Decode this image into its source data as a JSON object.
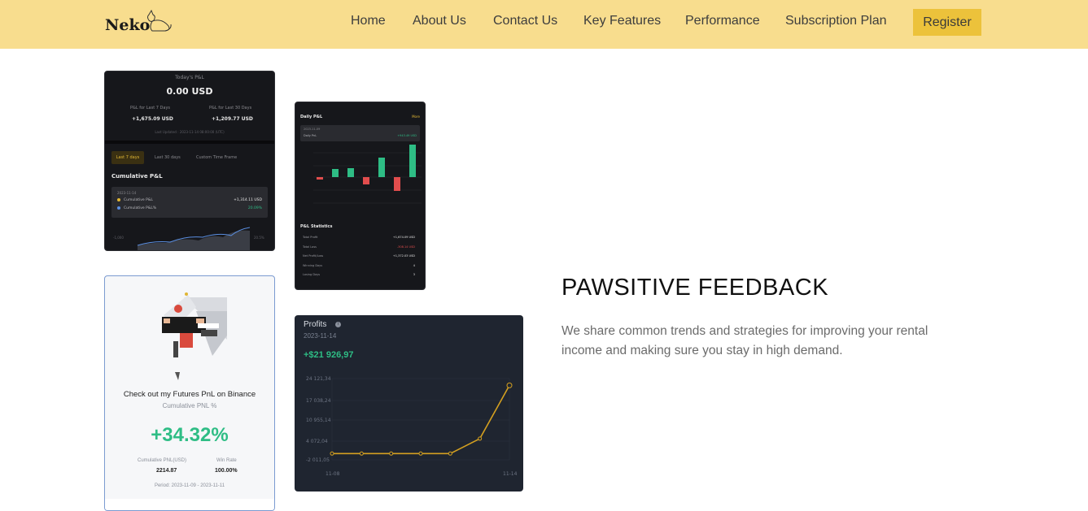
{
  "nav": {
    "logo": "Neko",
    "links": [
      "Home",
      "About Us",
      "Contact Us",
      "Key Features",
      "Performance",
      "Subscription Plan"
    ],
    "register": "Register",
    "bg_color": "#f8dd8e",
    "register_color": "#ecc23b"
  },
  "section": {
    "heading": "PAWSITIVE FEEDBACK",
    "description": "We share common trends and strategies for improving your rental income and making sure you stay in high demand."
  },
  "card_pnl": {
    "title": "Today's P&L",
    "value": "0.00 USD",
    "left_label": "P&L for Last 7 Days",
    "left_value": "+1,675.09 USD",
    "right_label": "P&L for Last 30 Days",
    "right_value": "+1,209.77 USD",
    "updated": "Last Updated : 2023-11-14 08:00:00 (UTC)",
    "tabs": [
      "Last 7 days",
      "Last 30 days",
      "Custom Time Frame"
    ],
    "section_title": "Cumulative P&L",
    "date": "2023-11-14",
    "rows": [
      {
        "label": "Cumulative P&L",
        "value": "+1,314.11 USD"
      },
      {
        "label": "Cumulative P&L%",
        "value": "20.09%"
      }
    ],
    "axis_left": "-1,000",
    "axis_right": "20.5%"
  },
  "card_daily": {
    "title": "Daily P&L",
    "more": "More",
    "tooltip_date": "2023-11-09",
    "tooltip_label": "Daily PnL",
    "tooltip_value": "+943.49 USD",
    "stats_title": "P&L Statistics",
    "stats": [
      {
        "label": "Total Profit",
        "value": "+1,674.09 USD",
        "color": "#e6e6e6"
      },
      {
        "label": "Total Loss",
        "value": "-308.14 USD",
        "color": "#e24d4d"
      },
      {
        "label": "Net Profit/Loss",
        "value": "+1,372.03 USD",
        "color": "#e6e6e6"
      },
      {
        "label": "Winning Days",
        "value": "4",
        "color": "#e6e6e6"
      },
      {
        "label": "Losing Days",
        "value": "3",
        "color": "#e6e6e6"
      }
    ],
    "bars": [
      -0.15,
      0.5,
      0.55,
      -0.45,
      1.2,
      -0.85,
      2.0
    ]
  },
  "card_binance": {
    "headline": "Check out my Futures PnL on Binance",
    "sub": "Cumulative PNL %",
    "pnl": "+34.32%",
    "stat1_label": "Cumulative PNL(USD)",
    "stat1_value": "2214.87",
    "stat2_label": "Win Rate",
    "stat2_value": "100.00%",
    "period": "Period: 2023-11-09 - 2023-11-11",
    "pnl_color": "#2ebd85"
  },
  "chart_data": {
    "type": "line",
    "title": "Profits",
    "date": "2023-11-14",
    "total": "+$21 926,97",
    "y_ticks": [
      "24 121,34",
      "17 038,24",
      "10 955,14",
      "4 072,04",
      "-2 011,05"
    ],
    "x_ticks": [
      "11-08",
      "11-14"
    ],
    "ylim": [
      -2011.05,
      24121.34
    ],
    "x": [
      "11-08",
      "11-09",
      "11-10",
      "11-11",
      "11-12",
      "11-13",
      "11-14"
    ],
    "values": [
      0,
      0,
      0,
      0,
      0,
      4800,
      21926.97
    ],
    "line_color": "#d4a020"
  }
}
